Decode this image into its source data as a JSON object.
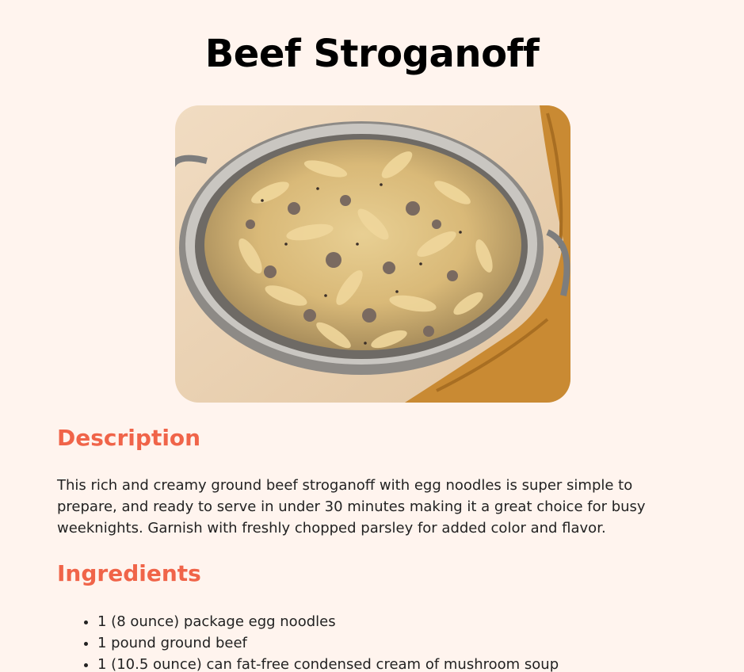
{
  "recipe": {
    "title": "Beef Stroganoff",
    "image_alt": "Beef stroganoff with egg noodles in a skillet",
    "description_heading": "Description",
    "description": "This rich and creamy ground beef stroganoff with egg noodles is super simple to prepare, and ready to serve in under 30 minutes making it a great choice for busy weeknights. Garnish with freshly chopped parsley for added color and flavor.",
    "ingredients_heading": "Ingredients",
    "ingredients": [
      "1 (8 ounce) package egg noodles",
      "1 pound ground beef",
      "1 (10.5 ounce) can fat-free condensed cream of mushroom soup"
    ]
  },
  "colors": {
    "background": "#fff4ee",
    "heading_accent": "#f06449",
    "title": "#000000",
    "body_text": "#222222"
  }
}
